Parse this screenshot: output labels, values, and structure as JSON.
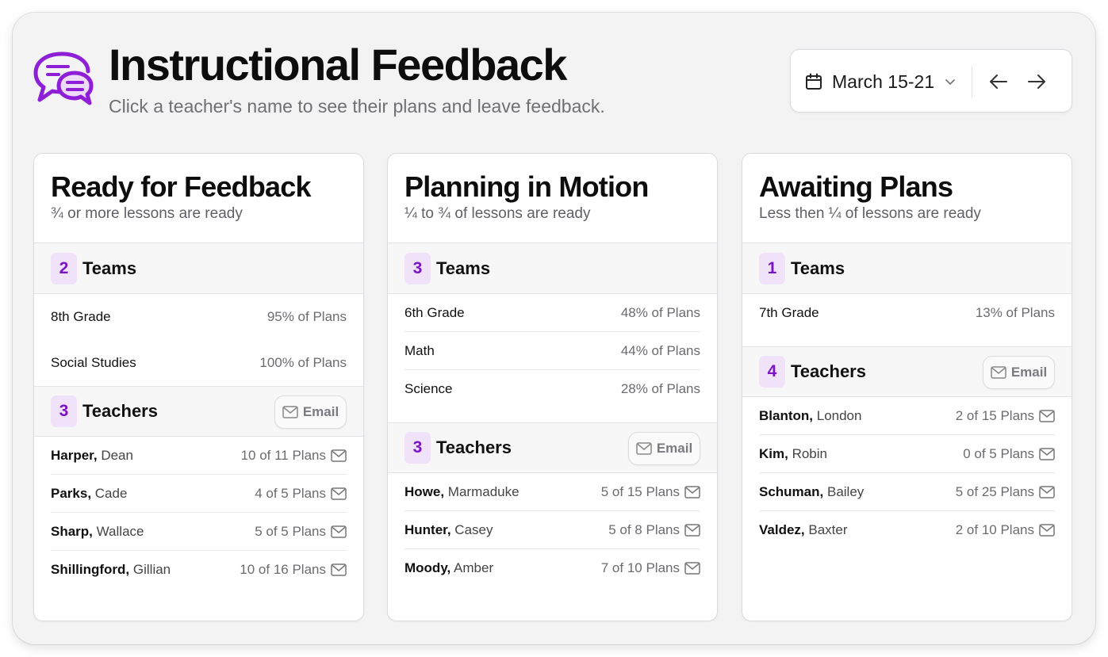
{
  "header": {
    "title": "Instructional Feedback",
    "subtitle": "Click a teacher's name to see their plans and leave feedback.",
    "logo_icon": "chat-bubbles-icon",
    "accent_color": "#7a14c4"
  },
  "date_picker": {
    "range": "March 15-21",
    "prev_icon": "arrow-left-icon",
    "next_icon": "arrow-right-icon"
  },
  "columns": [
    {
      "title": "Ready for Feedback",
      "description": "¾ or more lessons are ready",
      "teams_count": "2",
      "teams_label": "Teams",
      "teams": [
        {
          "name": "8th Grade",
          "value": "95% of Plans"
        },
        {
          "name": "Social Studies",
          "value": "100% of Plans"
        }
      ],
      "teachers_count": "3",
      "teachers_label": "Teachers",
      "email_label": "Email",
      "teachers": [
        {
          "last": "Harper,",
          "first": "Dean",
          "value": "10 of 11 Plans"
        },
        {
          "last": "Parks,",
          "first": "Cade",
          "value": "4 of 5 Plans"
        },
        {
          "last": "Sharp,",
          "first": "Wallace",
          "value": "5 of 5 Plans"
        },
        {
          "last": "Shillingford,",
          "first": "Gillian",
          "value": "10 of 16 Plans"
        }
      ]
    },
    {
      "title": "Planning in Motion",
      "description": "¼ to ¾ of lessons are ready",
      "teams_count": "3",
      "teams_label": "Teams",
      "teams": [
        {
          "name": "6th Grade",
          "value": "48% of Plans"
        },
        {
          "name": "Math",
          "value": "44% of Plans"
        },
        {
          "name": "Science",
          "value": "28% of Plans"
        }
      ],
      "teachers_count": "3",
      "teachers_label": "Teachers",
      "email_label": "Email",
      "teachers": [
        {
          "last": "Howe,",
          "first": "Marmaduke",
          "value": "5 of 15 Plans"
        },
        {
          "last": "Hunter,",
          "first": "Casey",
          "value": "5 of 8 Plans"
        },
        {
          "last": "Moody,",
          "first": "Amber",
          "value": "7 of 10 Plans"
        }
      ]
    },
    {
      "title": "Awaiting Plans",
      "description": "Less then ¼ of lessons are ready",
      "teams_count": "1",
      "teams_label": "Teams",
      "teams": [
        {
          "name": "7th Grade",
          "value": "13% of Plans"
        }
      ],
      "teachers_count": "4",
      "teachers_label": "Teachers",
      "email_label": "Email",
      "teachers": [
        {
          "last": "Blanton,",
          "first": "London",
          "value": "2 of 15 Plans"
        },
        {
          "last": "Kim,",
          "first": "Robin",
          "value": "0 of 5 Plans"
        },
        {
          "last": "Schuman,",
          "first": "Bailey",
          "value": "5 of 25 Plans"
        },
        {
          "last": "Valdez,",
          "first": "Baxter",
          "value": "2 of 10 Plans"
        }
      ]
    }
  ]
}
